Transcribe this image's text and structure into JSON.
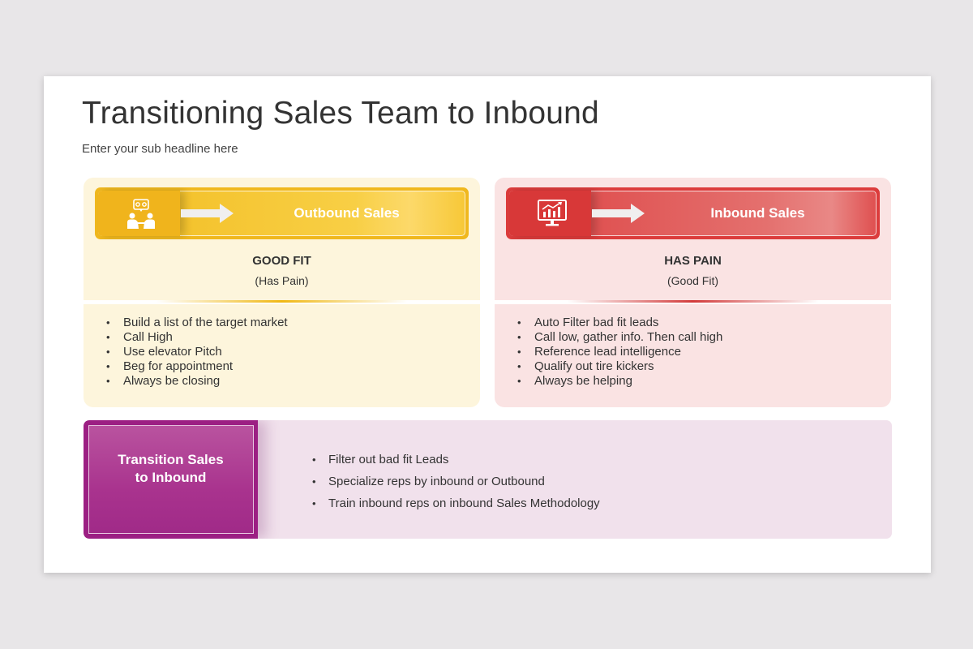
{
  "slide": {
    "title": "Transitioning Sales Team to Inbound",
    "subtitle": "Enter your sub headline here"
  },
  "colors": {
    "outbound": "#f0b81e",
    "inbound": "#dc3c3c",
    "transition": "#9c1f83"
  },
  "outbound": {
    "icon": "meeting-people-icon",
    "label": "Outbound Sales",
    "heading": "GOOD FIT",
    "subheading": "(Has Pain)",
    "bullets": [
      "Build a list of the target market",
      "Call High",
      "Use elevator Pitch",
      "Beg for appointment",
      "Always be closing"
    ]
  },
  "inbound": {
    "icon": "monitor-chart-icon",
    "label": "Inbound Sales",
    "heading": "HAS PAIN",
    "subheading": "(Good Fit)",
    "bullets": [
      "Auto Filter bad fit leads",
      "Call low, gather info. Then call high",
      "Reference lead intelligence",
      "Qualify out tire kickers",
      "Always be helping"
    ]
  },
  "transition": {
    "label": "Transition Sales to Inbound",
    "bullets": [
      "Filter out bad fit Leads",
      "Specialize reps by inbound or Outbound",
      "Train inbound reps on inbound Sales Methodology"
    ]
  }
}
